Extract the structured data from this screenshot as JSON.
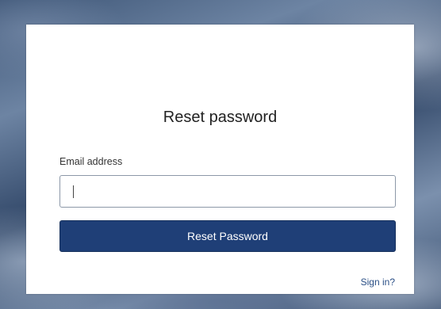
{
  "form": {
    "title": "Reset password",
    "email_label": "Email address",
    "email_value": "",
    "submit_label": "Reset Password",
    "sign_in_link": "Sign in?"
  },
  "colors": {
    "button_bg": "#1f3f77",
    "link": "#2a4f86",
    "input_border": "#8c98a8"
  }
}
